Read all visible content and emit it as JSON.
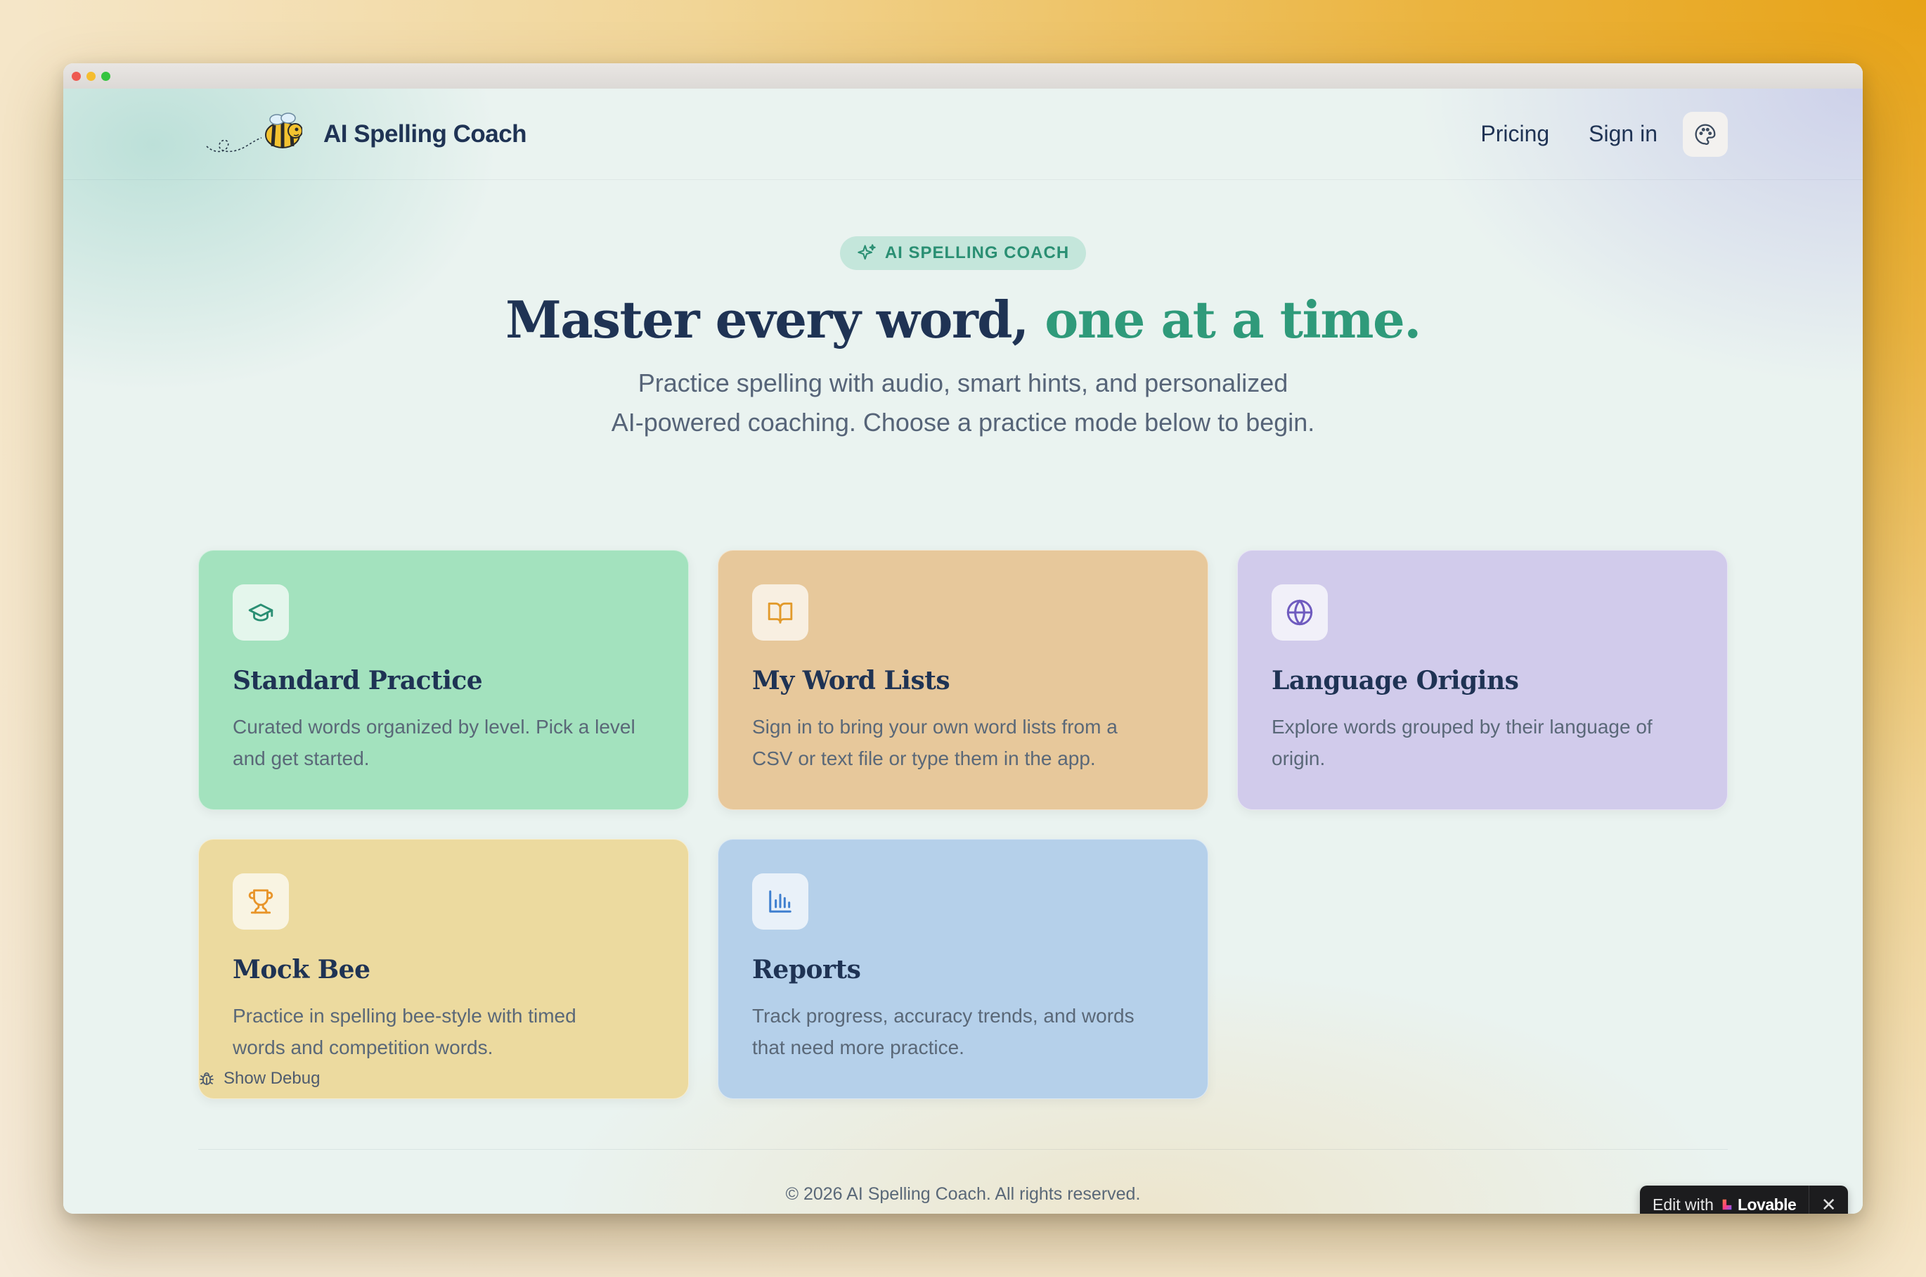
{
  "brand": {
    "name": "AI Spelling Coach",
    "logo_icon": "bee-icon"
  },
  "nav": {
    "pricing": "Pricing",
    "signin": "Sign in",
    "theme_icon": "palette-icon"
  },
  "hero": {
    "badge": "AI SPELLING COACH",
    "headline_main": "Master every word, ",
    "headline_accent": "one at a time.",
    "subtitle_line1": "Practice spelling with audio, smart hints, and personalized",
    "subtitle_line2": "AI-powered coaching. Choose a practice mode below to begin."
  },
  "cards": [
    {
      "title": "Standard Practice",
      "desc_line1": "Curated words organized by level. Pick a level",
      "desc_line2": "and get started.",
      "icon": "graduation-cap-icon",
      "color": "#a3e2be",
      "icon_color": "#2a8f73"
    },
    {
      "title": "My Word Lists",
      "desc_line1": "Sign in to bring your own word lists from a",
      "desc_line2": "CSV or text file or type them in the app.",
      "icon": "book-open-icon",
      "color": "#e7c89b",
      "icon_color": "#e29a2b"
    },
    {
      "title": "Language Origins",
      "desc_line1": "Explore words grouped by their language of",
      "desc_line2": "origin.",
      "icon": "globe-icon",
      "color": "#d1cbeb",
      "icon_color": "#6f5bbf"
    },
    {
      "title": "Mock Bee",
      "desc_line1": "Practice in spelling bee-style with timed",
      "desc_line2": "words and competition words.",
      "icon": "trophy-icon",
      "color": "#ecda9f",
      "icon_color": "#e8952a"
    },
    {
      "title": "Reports",
      "desc_line1": "Track progress, accuracy trends, and words",
      "desc_line2": "that need more practice.",
      "icon": "bar-chart-icon",
      "color": "#b5d0ea",
      "icon_color": "#3f7fcf"
    }
  ],
  "debug": {
    "label": "Show Debug",
    "icon": "bug-icon"
  },
  "footer": {
    "copyright": "© 2026 AI Spelling Coach. All rights reserved."
  },
  "lovable": {
    "prefix": "Edit with",
    "brand": "Lovable",
    "close": "✕"
  }
}
